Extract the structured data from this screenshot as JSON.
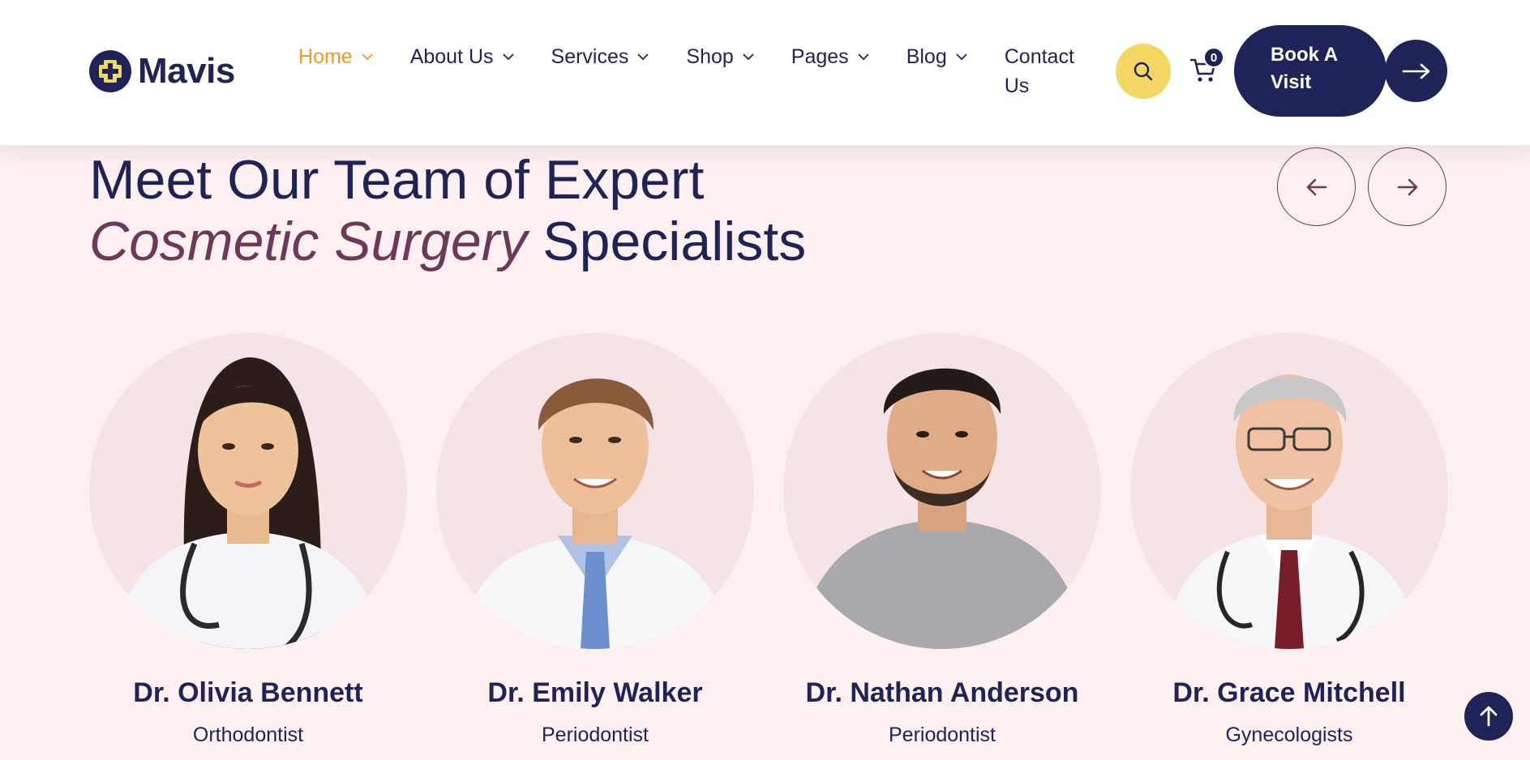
{
  "brand": {
    "name": "Mavis",
    "logo_icon": "medical-cross-icon"
  },
  "nav": {
    "items": [
      {
        "label": "Home",
        "active": true
      },
      {
        "label": "About Us",
        "active": false
      },
      {
        "label": "Services",
        "active": false
      },
      {
        "label": "Shop",
        "active": false
      },
      {
        "label": "Pages",
        "active": false
      },
      {
        "label": "Blog",
        "active": false
      }
    ],
    "contact_line1": "Contact",
    "contact_line2": "Us"
  },
  "header_actions": {
    "search_icon": "search-icon",
    "cart_icon": "cart-icon",
    "cart_count": "0",
    "book_line1": "Book A",
    "book_line2": "Visit",
    "book_arrow_icon": "arrow-right-icon"
  },
  "section": {
    "title_line1": "Meet Our Team of Expert",
    "title_italic": "Cosmetic Surgery",
    "title_rest": " Specialists"
  },
  "team": [
    {
      "name": "Dr. Olivia Bennett",
      "role": "Orthodontist"
    },
    {
      "name": "Dr. Emily Walker",
      "role": "Periodontist"
    },
    {
      "name": "Dr. Nathan Anderson",
      "role": "Periodontist"
    },
    {
      "name": "Dr. Grace Mitchell",
      "role": "Gynecologists"
    }
  ],
  "colors": {
    "navy": "#1f2358",
    "accent_orange": "#f29a1f",
    "accent_yellow": "#f2d862",
    "plum": "#6e3858",
    "background": "#fcf0f1"
  }
}
